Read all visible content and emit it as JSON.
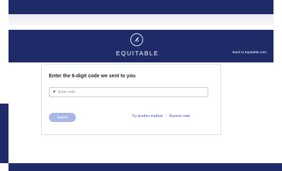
{
  "header": {
    "brand": "EQUITABLE",
    "back_link": "Back to Equitable.com"
  },
  "verify": {
    "title": "Enter the 6-digit code we sent to you",
    "code_placeholder": "Enter code",
    "code_prefix": "#",
    "submit_label": "Submit",
    "try_another_label": "Try another method",
    "separator": "|",
    "resend_label": "Resend code"
  },
  "colors": {
    "navy": "#1f2b68",
    "link": "#3f54c4",
    "submit_disabled": "#a9b6e6"
  }
}
